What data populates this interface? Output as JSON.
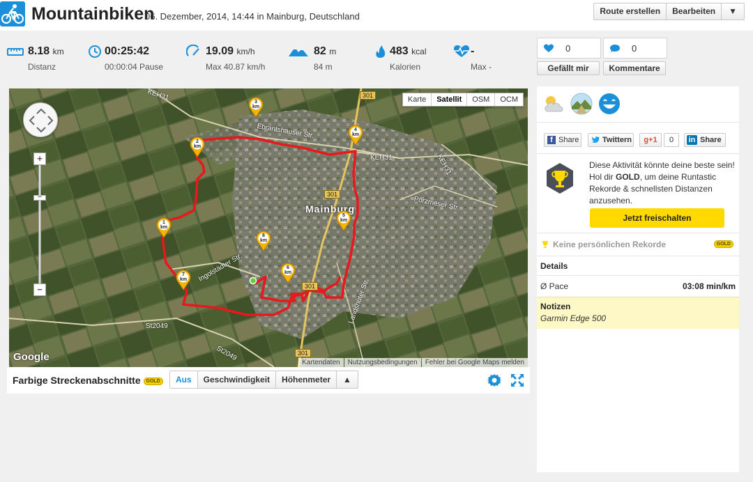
{
  "header": {
    "title": "Mountainbiken",
    "subtitle": "06. Dezember, 2014, 14:44 in Mainburg, Deutschland",
    "buttons": {
      "create_route": "Route erstellen",
      "edit": "Bearbeiten",
      "dropdown": "▼"
    }
  },
  "stats": {
    "distance": {
      "value": "8.18",
      "unit": "km",
      "label": "Distanz"
    },
    "duration": {
      "value": "00:25:42",
      "sub": "00:00:04 Pause"
    },
    "speed": {
      "value": "19.09",
      "unit": "km/h",
      "sub": "Max 40.87 km/h"
    },
    "elevation": {
      "value": "82",
      "unit": "m",
      "sub": "84 m"
    },
    "calories": {
      "value": "483",
      "unit": "kcal",
      "label": "Kalorien"
    },
    "heart_rate": {
      "value": "-",
      "sub": "Max -"
    }
  },
  "social": {
    "likes_count": "0",
    "comments_count": "0",
    "like_label": "Gefällt mir",
    "comments_label": "Kommentare"
  },
  "map": {
    "types": [
      "Karte",
      "Satellit",
      "OSM",
      "OCM"
    ],
    "active_type": "Satellit",
    "town_label": "Mainburg",
    "street_labels": {
      "keh31_top": "KEH31",
      "r301_top": "301",
      "ebrantshauser": "Ebrantshauser Str.",
      "keh31_right": "KEH31",
      "keh31_far": "KEH31",
      "r301_mid": "301",
      "poerzmeser": "Pörzmeser Str.",
      "ingolstaedter": "Ingolstädter Str.",
      "r301_low": "301",
      "landshuter": "Landshuter Str.",
      "st2049_a": "St2049",
      "st2049_b": "St2049",
      "r301_bottom": "301"
    },
    "km_markers": [
      {
        "n": "1",
        "unit": "km"
      },
      {
        "n": "2",
        "unit": "km"
      },
      {
        "n": "3",
        "unit": "km"
      },
      {
        "n": "4",
        "unit": "km"
      },
      {
        "n": "5",
        "unit": "km"
      },
      {
        "n": "6",
        "unit": "km"
      },
      {
        "n": "7",
        "unit": "km"
      },
      {
        "n": "8",
        "unit": "km"
      }
    ],
    "zoom_in": "+",
    "zoom_out": "−",
    "google": "Google",
    "attribution": [
      "Kartendaten",
      "Nutzungsbedingungen",
      "Fehler bei Google Maps melden"
    ]
  },
  "route_segments": {
    "label": "Farbige Streckenabschnitte",
    "gold": "GOLD",
    "options": [
      "Aus",
      "Geschwindigkeit",
      "Höhenmeter"
    ],
    "active": "Aus",
    "toggle": "▲"
  },
  "share": {
    "facebook": "Share",
    "twitter": "Twittern",
    "gplus": "+1",
    "gplus_count": "0",
    "linkedin": "Share"
  },
  "gold_promo": {
    "text_1": "Diese Aktivität könnte deine beste sein! Hol dir ",
    "text_bold": "GOLD",
    "text_2": ", um deine Runtastic Rekorde & schnellsten Distanzen anzusehen.",
    "cta": "Jetzt freischalten"
  },
  "records": {
    "label": "Keine persönlichen Rekorde",
    "gold": "GOLD"
  },
  "details": {
    "heading": "Details",
    "pace_label": "Ø Pace",
    "pace_value": "03:08 min/km"
  },
  "notes": {
    "heading": "Notizen",
    "text": "Garmin Edge 500"
  },
  "colors": {
    "accent": "#1b8fd8",
    "gold": "#ffd900",
    "route": "#e8181d",
    "notes_bg": "#fdf8c5"
  }
}
